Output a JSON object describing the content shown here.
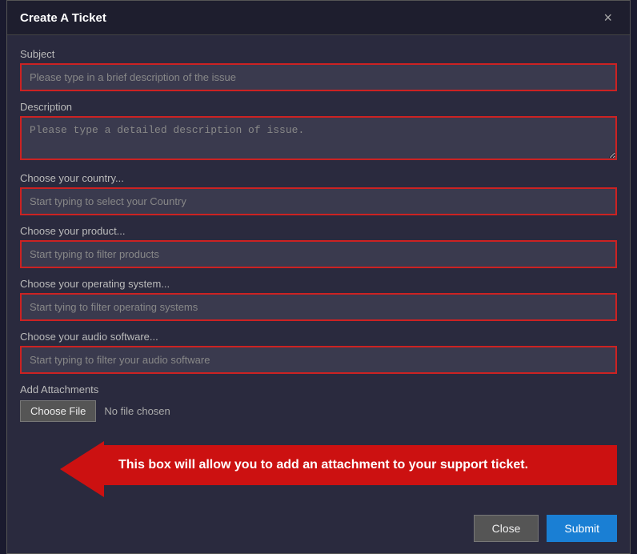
{
  "modal": {
    "title": "Create A Ticket",
    "close_icon": "×"
  },
  "fields": {
    "subject_label": "Subject",
    "subject_placeholder": "Please type in a brief description of the issue",
    "description_label": "Description",
    "description_placeholder": "Please type a detailed description of issue.",
    "country_label": "Choose your country...",
    "country_placeholder": "Start typing to select your Country",
    "product_label": "Choose your product...",
    "product_placeholder": "Start typing to filter products",
    "os_label": "Choose your operating system...",
    "os_placeholder": "Start tying to filter operating systems",
    "audio_label": "Choose your audio software...",
    "audio_placeholder": "Start typing to filter your audio software"
  },
  "attachments": {
    "label": "Add Attachments",
    "choose_file_label": "Choose File",
    "no_file_text": "No file chosen"
  },
  "tooltip": {
    "text": "This box will allow you to add an attachment to your support ticket."
  },
  "footer": {
    "close_label": "Close",
    "submit_label": "Submit"
  }
}
